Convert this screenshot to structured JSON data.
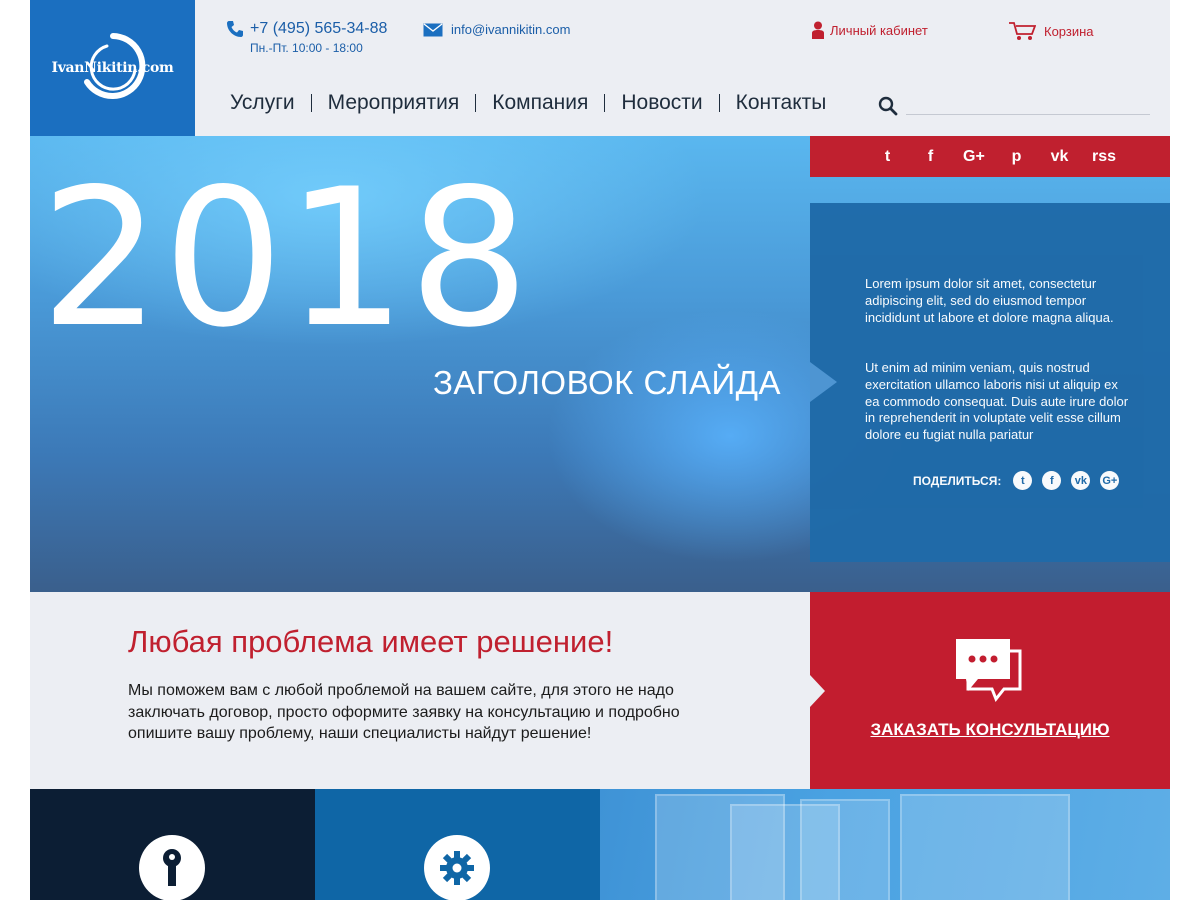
{
  "header": {
    "logo_text": "IvanNikitin.com",
    "phone": "+7 (495) 565-34-88",
    "hours": "Пн.-Пт. 10:00 - 18:00",
    "email": "info@ivannikitin.com",
    "account_label": "Личный кабинет",
    "cart_label": "Корзина"
  },
  "nav": {
    "items": [
      {
        "label": "Услуги"
      },
      {
        "label": "Мероприятия"
      },
      {
        "label": "Компания"
      },
      {
        "label": "Новости"
      },
      {
        "label": "Контакты"
      }
    ],
    "search_placeholder": ""
  },
  "social": {
    "icons": [
      {
        "name": "twitter-icon",
        "glyph": "t"
      },
      {
        "name": "facebook-icon",
        "glyph": "f"
      },
      {
        "name": "google-plus-icon",
        "glyph": "G+"
      },
      {
        "name": "pinterest-icon",
        "glyph": "p"
      },
      {
        "name": "vk-icon",
        "glyph": "vk"
      },
      {
        "name": "rss-icon",
        "glyph": "rss"
      }
    ]
  },
  "hero": {
    "year": "2018",
    "title": "ЗАГОЛОВОК СЛАЙДА",
    "paragraph1": "Lorem ipsum dolor sit amet, consectetur adipiscing elit, sed do eiusmod tempor incididunt ut labore et dolore magna aliqua.",
    "paragraph2": "Ut enim ad minim veniam, quis nostrud exercitation ullamco laboris nisi ut aliquip ex ea commodo consequat. Duis aute irure dolor in reprehenderit in voluptate velit esse cillum dolore eu fugiat nulla pariatur",
    "share_label": "ПОДЕЛИТЬСЯ:"
  },
  "promo": {
    "title": "Любая проблема имеет решение!",
    "text": "Мы поможем вам с любой проблемой на вашем сайте, для этого не надо заключать договор, просто оформите заявку на консультацию и подробно опишите вашу проблему, наши специалисты найдут решение!",
    "cta_label": "ЗАКАЗАТЬ КОНСУЛЬТАЦИЮ"
  },
  "colors": {
    "brand_blue": "#1b6fc0",
    "accent_red": "#c0202f",
    "dark_navy": "#0c1e34",
    "bg_light": "#eceef3"
  }
}
